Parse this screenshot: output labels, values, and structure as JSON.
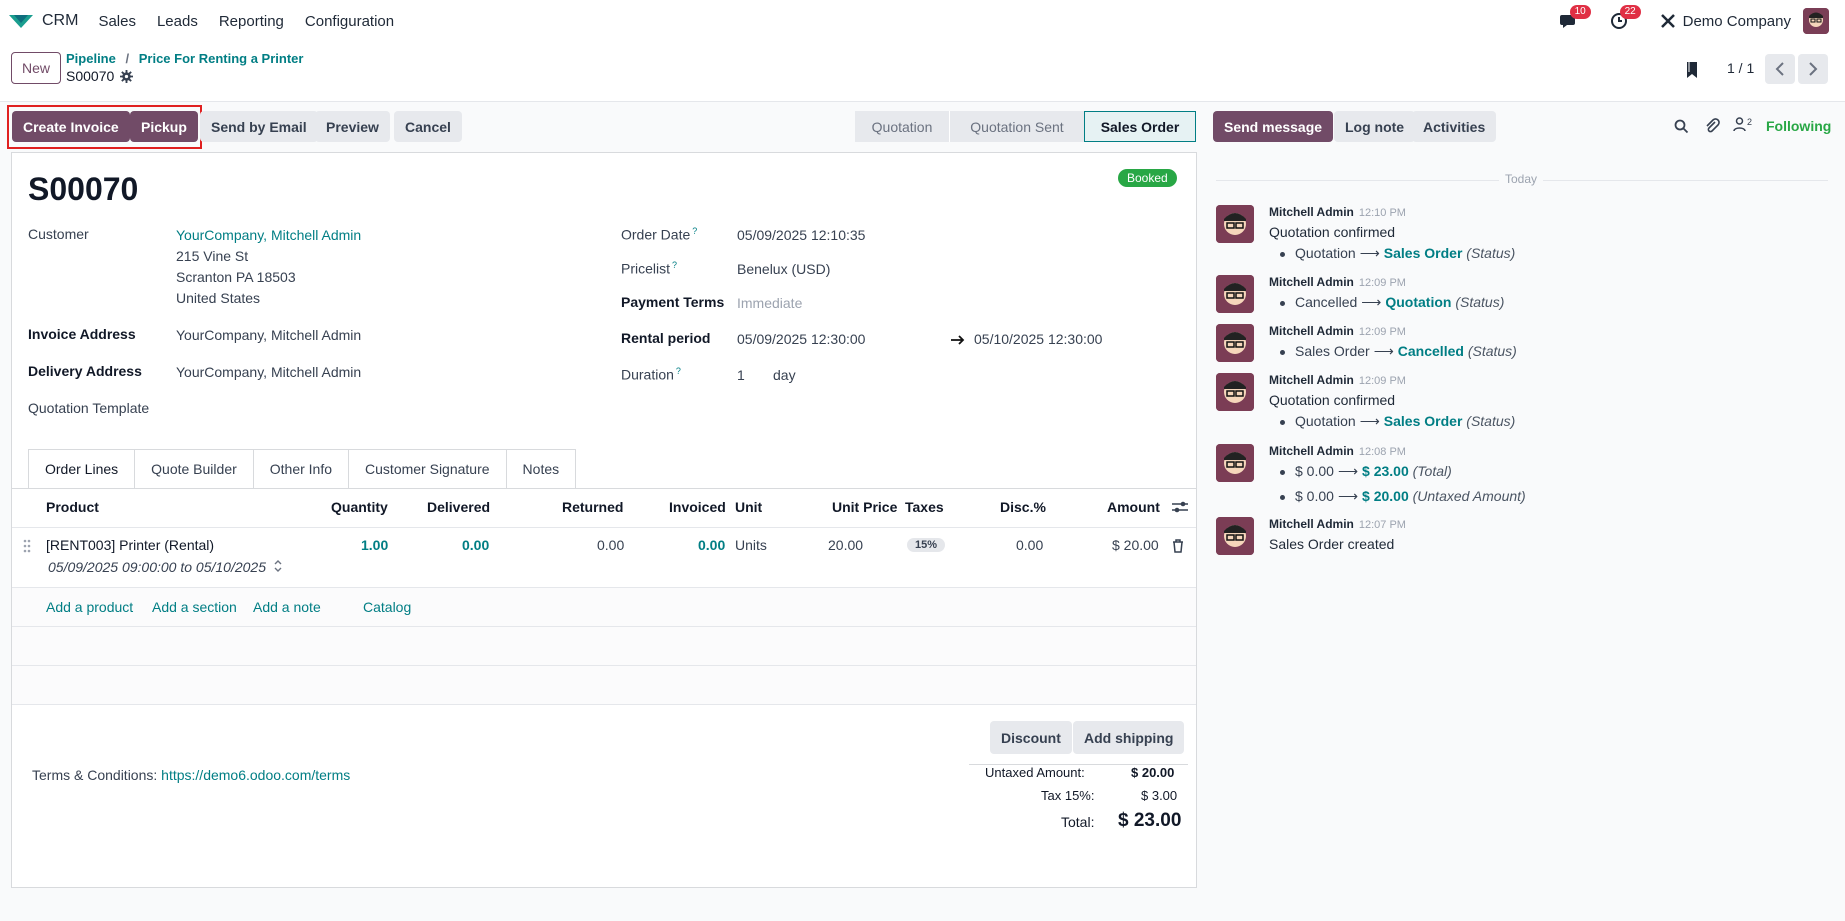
{
  "nav": {
    "app_name": "CRM",
    "menu": [
      "Sales",
      "Leads",
      "Reporting",
      "Configuration"
    ],
    "messages_count": "10",
    "activities_count": "22",
    "company": "Demo Company"
  },
  "control_panel": {
    "new_label": "New",
    "breadcrumb_root": "Pipeline",
    "breadcrumb_sep": "/",
    "breadcrumb_parent": "Price For Renting a Printer",
    "current_record": "S00070",
    "pager": "1 / 1"
  },
  "actions": {
    "create_invoice": "Create Invoice",
    "pickup": "Pickup",
    "send_email": "Send by Email",
    "preview": "Preview",
    "cancel": "Cancel"
  },
  "status_steps": [
    "Quotation",
    "Quotation Sent",
    "Sales Order"
  ],
  "status_active": "Sales Order",
  "form": {
    "ribbon": "Booked",
    "name": "S00070",
    "customer_label": "Customer",
    "customer_name": "YourCompany, Mitchell Admin",
    "customer_addr1": "215 Vine St",
    "customer_addr2": "Scranton PA 18503",
    "customer_addr3": "United States",
    "invoice_address_label": "Invoice Address",
    "invoice_address": "YourCompany, Mitchell Admin",
    "delivery_address_label": "Delivery Address",
    "delivery_address": "YourCompany, Mitchell Admin",
    "quotation_template_label": "Quotation Template",
    "order_date_label": "Order Date",
    "order_date": "05/09/2025 12:10:35",
    "pricelist_label": "Pricelist",
    "pricelist": "Benelux (USD)",
    "payment_terms_label": "Payment Terms",
    "payment_terms_placeholder": "Immediate",
    "rental_period_label": "Rental period",
    "rental_start": "05/09/2025 12:30:00",
    "rental_end": "05/10/2025 12:30:00",
    "duration_label": "Duration",
    "duration_value": "1",
    "duration_unit": "day",
    "help_mark": "?"
  },
  "tabs": [
    "Order Lines",
    "Quote Builder",
    "Other Info",
    "Customer Signature",
    "Notes"
  ],
  "lines": {
    "headers": {
      "product": "Product",
      "quantity": "Quantity",
      "delivered": "Delivered",
      "returned": "Returned",
      "invoiced": "Invoiced",
      "unit": "Unit",
      "unit_price": "Unit Price",
      "taxes": "Taxes",
      "disc": "Disc.%",
      "amount": "Amount"
    },
    "row": {
      "product": "[RENT003] Printer (Rental)",
      "description": "05/09/2025 09:00:00 to 05/10/2025",
      "quantity": "1.00",
      "delivered": "0.00",
      "returned": "0.00",
      "invoiced": "0.00",
      "unit": "Units",
      "unit_price": "20.00",
      "tax": "15%",
      "disc": "0.00",
      "amount": "$ 20.00"
    },
    "add_product": "Add a product",
    "add_section": "Add a section",
    "add_note": "Add a note",
    "catalog": "Catalog"
  },
  "footer": {
    "discount": "Discount",
    "add_shipping": "Add shipping",
    "terms_label": "Terms & Conditions:",
    "terms_link": "https://demo6.odoo.com/terms",
    "untaxed_label": "Untaxed Amount:",
    "untaxed_value": "$ 20.00",
    "tax_label": "Tax 15%:",
    "tax_value": "$ 3.00",
    "total_label": "Total:",
    "total_value": "$ 23.00"
  },
  "chatter": {
    "send_message": "Send message",
    "log_note": "Log note",
    "activities": "Activities",
    "followers_count": "2",
    "following": "Following",
    "day_separator": "Today",
    "messages": [
      {
        "author": "Mitchell Admin",
        "time": "12:10 PM",
        "body": "Quotation confirmed",
        "changes": [
          {
            "old": "Quotation",
            "new": "Sales Order",
            "field": "(Status)"
          }
        ]
      },
      {
        "author": "Mitchell Admin",
        "time": "12:09 PM",
        "body": "",
        "changes": [
          {
            "old": "Cancelled",
            "new": "Quotation",
            "field": "(Status)"
          }
        ]
      },
      {
        "author": "Mitchell Admin",
        "time": "12:09 PM",
        "body": "",
        "changes": [
          {
            "old": "Sales Order",
            "new": "Cancelled",
            "field": "(Status)"
          }
        ]
      },
      {
        "author": "Mitchell Admin",
        "time": "12:09 PM",
        "body": "Quotation confirmed",
        "changes": [
          {
            "old": "Quotation",
            "new": "Sales Order",
            "field": "(Status)"
          }
        ]
      },
      {
        "author": "Mitchell Admin",
        "time": "12:08 PM",
        "body": "",
        "changes": [
          {
            "old": "$ 0.00",
            "new": "$ 23.00",
            "field": "(Total)"
          },
          {
            "old": "$ 0.00",
            "new": "$ 20.00",
            "field": "(Untaxed Amount)"
          }
        ]
      },
      {
        "author": "Mitchell Admin",
        "time": "12:07 PM",
        "body": "Sales Order created",
        "changes": []
      }
    ]
  },
  "colors": {
    "brand": "#714b67",
    "link": "#017e84",
    "booked": "#28a745",
    "highlight_box": "#e02020"
  }
}
